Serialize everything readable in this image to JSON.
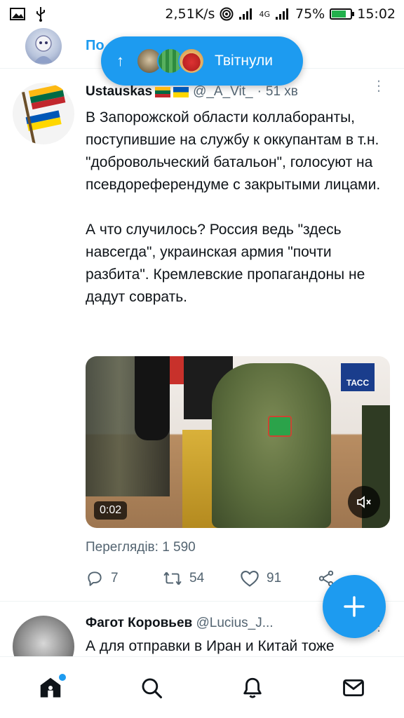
{
  "status_bar": {
    "speed": "2,51K/s",
    "network": "4G",
    "battery": "75%",
    "time": "15:02"
  },
  "header": {
    "title": "По"
  },
  "new_tweets_pill": {
    "label": "Твітнули"
  },
  "tweet": {
    "author_name": "Ustauskas",
    "handle": "@_A_Vit_",
    "separator": "·",
    "time": "51 хв",
    "text": "В Запорожской области коллаборанты, поступившие на службу к оккупантам в т.н. \"добровольческий батальон\", голосуют на псевдореферендуме с закрытыми лицами.\n\nА что случилось? Россия ведь \"здесь навсегда\", украинская армия \"почти разбита\". Кремлевские пропагандоны не дадут соврать.",
    "video": {
      "duration": "0:02",
      "watermark": "ТАСС"
    },
    "views": "Переглядів: 1 590",
    "replies": "7",
    "retweets": "54",
    "likes": "91"
  },
  "tweet2": {
    "author_name": "Фагот Коровьев",
    "handle": "@Lucius_J...",
    "text": "А для отправки в Иран и Китай тоже"
  },
  "colors": {
    "accent": "#1d9bf0",
    "text": "#0f1419",
    "secondary": "#536471"
  }
}
